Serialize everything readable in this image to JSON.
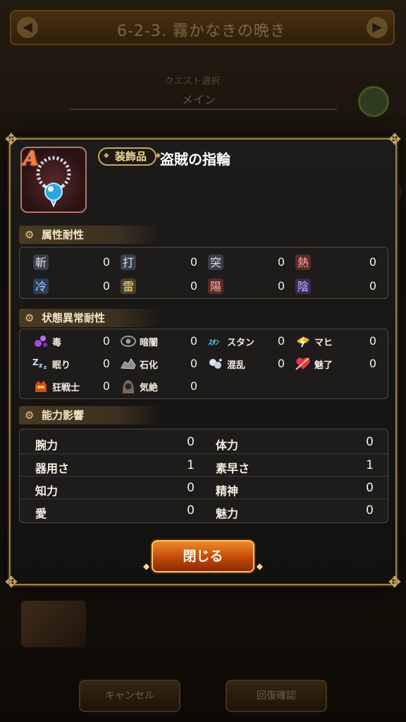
{
  "background": {
    "stage_title": "6-2-3. 霧かなきの晩き",
    "subtitle": "クエスト選択",
    "sub_label": "メイン",
    "cancel_label": "キャンセル",
    "confirm_label": "回復確認"
  },
  "item": {
    "rank": "A",
    "category": "装飾品",
    "name": "盗賊の指輪",
    "icon": "necklace-icon"
  },
  "attribute_resistance": {
    "title": "属性耐性",
    "rows": [
      [
        {
          "label": "斬",
          "icon": "slash-icon",
          "value": "0"
        },
        {
          "label": "打",
          "icon": "strike-icon",
          "value": "0"
        },
        {
          "label": "突",
          "icon": "thrust-icon",
          "value": "0"
        },
        {
          "label": "熱",
          "icon": "heat-icon",
          "value": "0"
        }
      ],
      [
        {
          "label": "冷",
          "icon": "cold-icon",
          "value": "0"
        },
        {
          "label": "雷",
          "icon": "lightning-icon",
          "value": "0"
        },
        {
          "label": "陽",
          "icon": "light-icon",
          "value": "0"
        },
        {
          "label": "陰",
          "icon": "dark-icon",
          "value": "0"
        }
      ]
    ]
  },
  "status_resistance": {
    "title": "状態異常耐性",
    "rows": [
      [
        {
          "label": "毒",
          "icon": "poison-icon",
          "value": "0"
        },
        {
          "label": "暗闇",
          "icon": "blind-icon",
          "value": "0"
        },
        {
          "label": "スタン",
          "icon": "stun-icon",
          "value": "0"
        },
        {
          "label": "マヒ",
          "icon": "paralysis-icon",
          "value": "0"
        }
      ],
      [
        {
          "label": "眠り",
          "icon": "sleep-icon",
          "value": "0"
        },
        {
          "label": "石化",
          "icon": "petrify-icon",
          "value": "0"
        },
        {
          "label": "混乱",
          "icon": "confusion-icon",
          "value": "0"
        },
        {
          "label": "魅了",
          "icon": "charm-icon",
          "value": "0"
        }
      ],
      [
        {
          "label": "狂戦士",
          "icon": "berserk-icon",
          "value": "0"
        },
        {
          "label": "気絶",
          "icon": "faint-icon",
          "value": "0"
        }
      ]
    ]
  },
  "ability": {
    "title": "能力影響",
    "rows": [
      [
        {
          "label": "腕力",
          "value": "0"
        },
        {
          "label": "体力",
          "value": "0"
        }
      ],
      [
        {
          "label": "器用さ",
          "value": "1"
        },
        {
          "label": "素早さ",
          "value": "1"
        }
      ],
      [
        {
          "label": "知力",
          "value": "0"
        },
        {
          "label": "精神",
          "value": "0"
        }
      ],
      [
        {
          "label": "愛",
          "value": "0"
        },
        {
          "label": "魅力",
          "value": "0"
        }
      ]
    ]
  },
  "close_label": "閉じる"
}
